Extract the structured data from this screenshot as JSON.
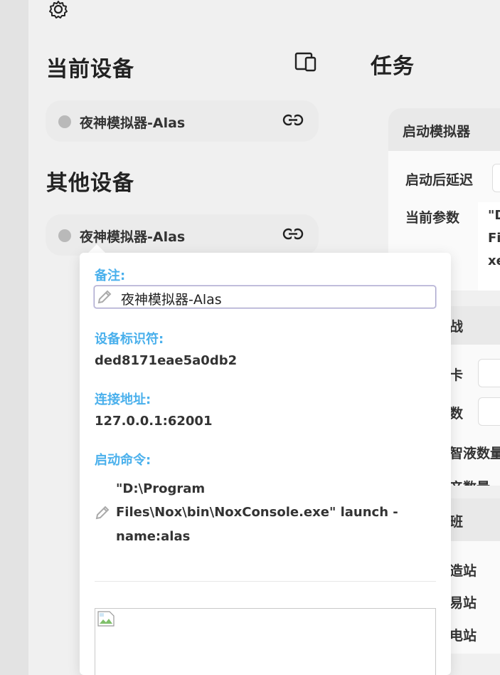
{
  "sections": {
    "current_devices_title": "当前设备",
    "other_devices_title": "其他设备",
    "tasks_title": "任务"
  },
  "current_device": {
    "name": "夜神模拟器-Alas"
  },
  "other_device": {
    "name": "夜神模拟器-Alas"
  },
  "task_panel": {
    "header": "启动模拟器",
    "delay_label": "启动后延迟",
    "params_label": "当前参数",
    "params_lines": [
      "\"D",
      "Fi",
      "xe"
    ]
  },
  "partial_labels": {
    "panel2_header": "战",
    "row1": "卡",
    "row2": "数",
    "row3": "智液数量",
    "row4": "产数量",
    "panel3_header": "班",
    "row5": "造站",
    "row6": "易站",
    "row7": "电站"
  },
  "popover": {
    "remark_label": "备注:",
    "remark_value": "夜神模拟器-Alas",
    "serial_label": "设备标识符:",
    "serial_value": "ded8171eae5a0db2",
    "address_label": "连接地址:",
    "address_value": "127.0.0.1:62001",
    "command_label": "启动命令:",
    "command_lines": [
      "\"D:\\Program",
      "Files\\Nox\\bin\\NoxConsole.exe\" launch -",
      "name:alas"
    ]
  },
  "colors": {
    "accent_label": "#4ab0ec",
    "background": "#f0f0f0",
    "status_dot": "#b9b9b9"
  }
}
